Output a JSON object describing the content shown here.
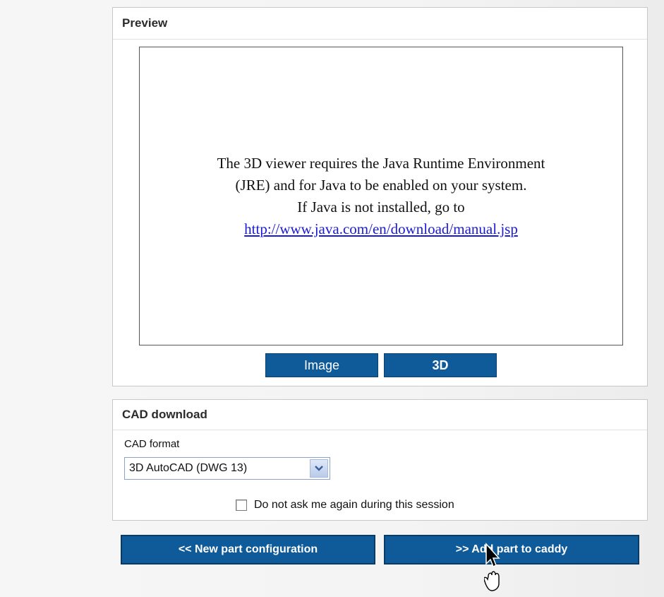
{
  "preview": {
    "title": "Preview",
    "viewer_lines": [
      "The 3D viewer requires the Java Runtime Environment",
      "(JRE) and for Java to be enabled on your system.",
      "If Java is not installed, go to"
    ],
    "viewer_link": "http://www.java.com/en/download/manual.jsp",
    "buttons": {
      "image": "Image",
      "three_d": "3D"
    }
  },
  "cad": {
    "title": "CAD download",
    "format_label": "CAD format",
    "format_value": "3D AutoCAD (DWG 13)",
    "checkbox_label": "Do not ask me again during this session",
    "checkbox_checked": false
  },
  "actions": {
    "new_part": "<< New part configuration",
    "add_part": ">> Add part to caddy"
  },
  "colors": {
    "button_bg": "#0f5a99",
    "link": "#1a1ad6"
  }
}
